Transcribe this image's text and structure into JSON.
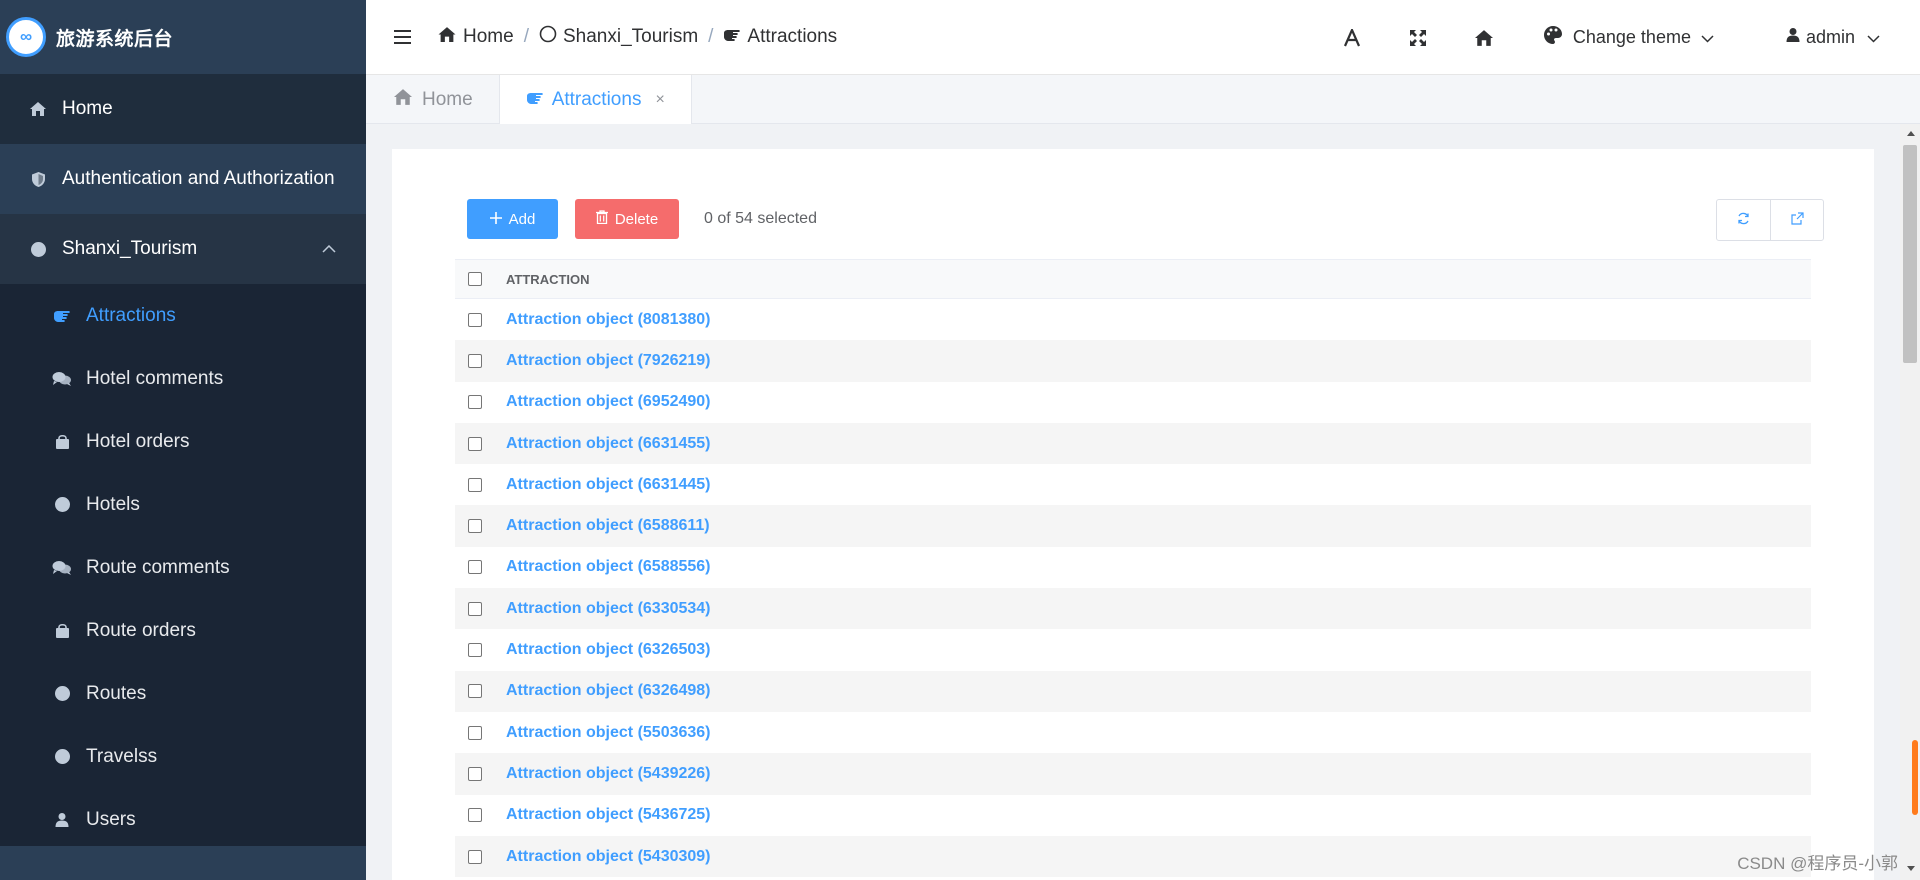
{
  "app": {
    "logo_letters": "∞",
    "title": "旅游系统后台"
  },
  "sidebar": {
    "top_items": [
      {
        "label": "Home",
        "icon": "home-icon"
      },
      {
        "label": "Authentication and Authorization",
        "icon": "shield-icon"
      },
      {
        "label": "Shanxi_Tourism",
        "icon": "circle-icon",
        "expanded": true
      }
    ],
    "sub_items": [
      {
        "label": "Attractions",
        "icon": "hand-point-icon",
        "active": true
      },
      {
        "label": "Hotel comments",
        "icon": "comments-icon"
      },
      {
        "label": "Hotel orders",
        "icon": "shopping-bag-icon"
      },
      {
        "label": "Hotels",
        "icon": "circle-icon"
      },
      {
        "label": "Route comments",
        "icon": "comments-icon"
      },
      {
        "label": "Route orders",
        "icon": "shopping-bag-icon"
      },
      {
        "label": "Routes",
        "icon": "circle-icon"
      },
      {
        "label": "Travelss",
        "icon": "circle-icon"
      },
      {
        "label": "Users",
        "icon": "user-icon"
      }
    ]
  },
  "header": {
    "breadcrumb": [
      {
        "label": "Home",
        "icon": "home-icon"
      },
      {
        "label": "Shanxi_Tourism",
        "icon": "circle-outline-icon"
      },
      {
        "label": "Attractions",
        "icon": "hand-point-icon"
      }
    ],
    "theme_label": "Change theme",
    "user_label": "admin"
  },
  "tabs": [
    {
      "label": "Home",
      "icon": "home-icon",
      "active": false
    },
    {
      "label": "Attractions",
      "icon": "hand-point-icon",
      "active": true,
      "close": "×"
    }
  ],
  "toolbar": {
    "add_label": "Add",
    "delete_label": "Delete",
    "selection_status": "0 of 54 selected"
  },
  "table": {
    "column_header": "ATTRACTION",
    "rows": [
      "Attraction object (8081380)",
      "Attraction object (7926219)",
      "Attraction object (6952490)",
      "Attraction object (6631455)",
      "Attraction object (6631445)",
      "Attraction object (6588611)",
      "Attraction object (6588556)",
      "Attraction object (6330534)",
      "Attraction object (6326503)",
      "Attraction object (6326498)",
      "Attraction object (5503636)",
      "Attraction object (5439226)",
      "Attraction object (5436725)",
      "Attraction object (5430309)"
    ]
  },
  "watermark": "CSDN @程序员-小郭",
  "colors": {
    "sidebar_bg": "#1f2d3d",
    "accent": "#409eff",
    "danger": "#f56c6c"
  }
}
